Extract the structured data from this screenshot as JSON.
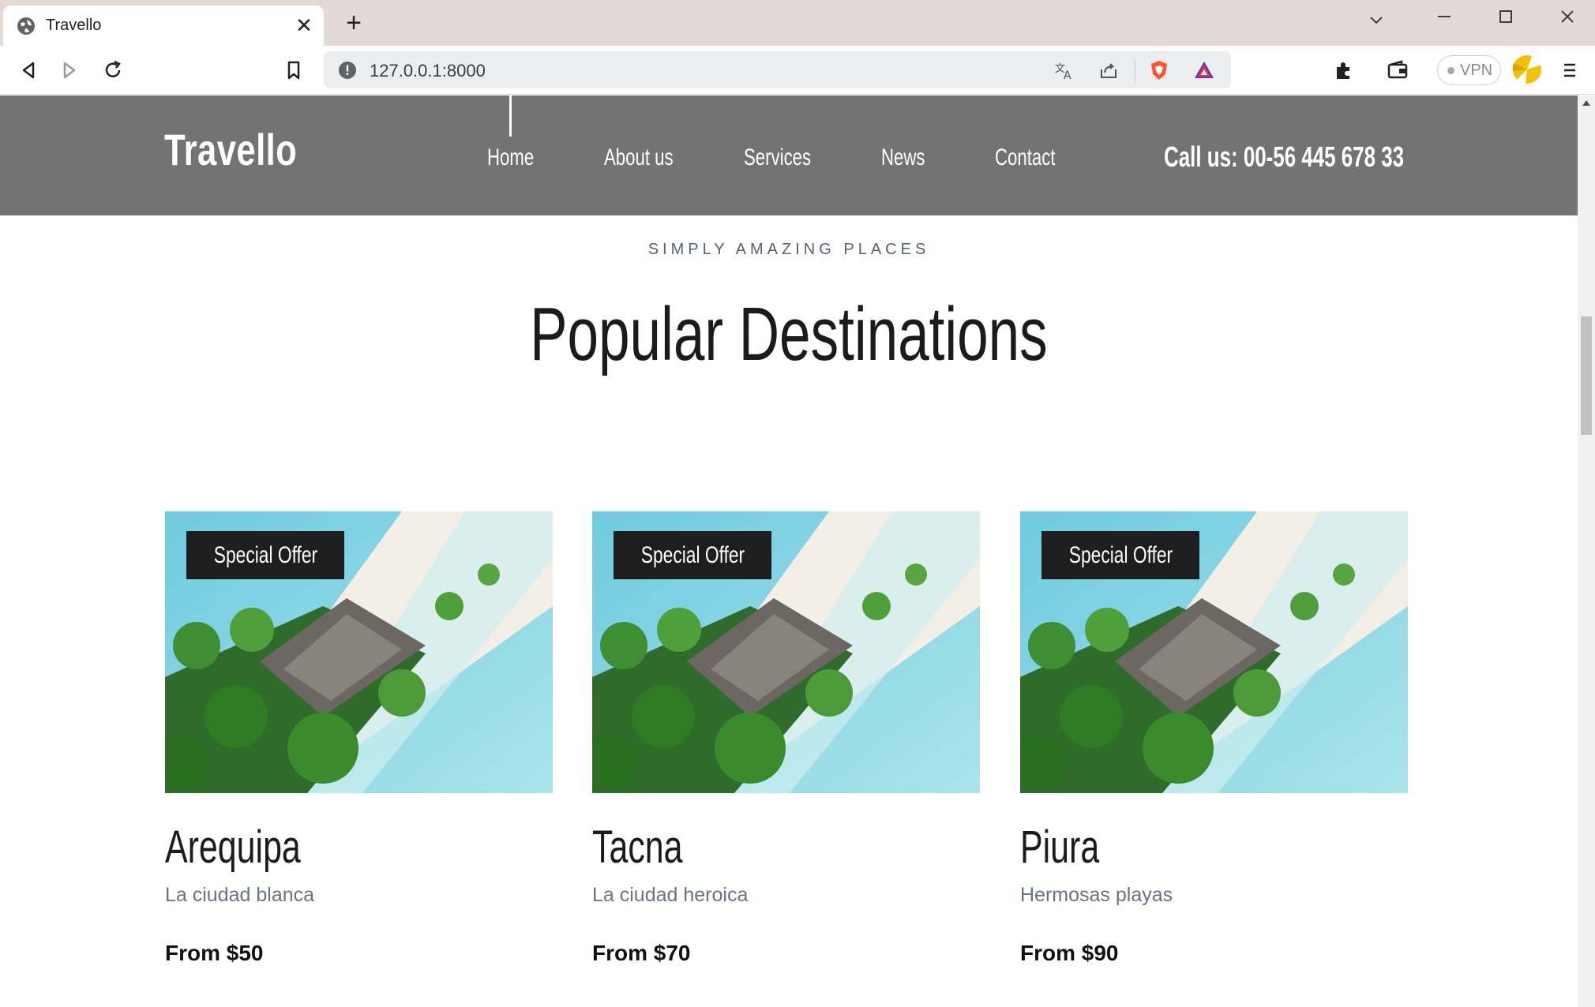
{
  "browser": {
    "tab_title": "Travello",
    "url": "127.0.0.1:8000",
    "vpn_label": "VPN"
  },
  "site": {
    "logo": "Travello",
    "nav": [
      "Home",
      "About us",
      "Services",
      "News",
      "Contact"
    ],
    "call": "Call us: 00-56 445 678 33"
  },
  "section": {
    "eyebrow": "SIMPLY AMAZING PLACES",
    "title": "Popular Destinations"
  },
  "destinations": [
    {
      "badge": "Special Offer",
      "city": "Arequipa",
      "description": "La ciudad blanca",
      "price": "From $50"
    },
    {
      "badge": "Special Offer",
      "city": "Tacna",
      "description": "La ciudad heroica",
      "price": "From $70"
    },
    {
      "badge": "Special Offer",
      "city": "Piura",
      "description": "Hermosas playas",
      "price": "From $90"
    }
  ],
  "colors": {
    "header_bg": "#737373",
    "tabbar_bg": "#e3dad6",
    "badge_bg": "#1e1e1e",
    "text_dark": "#1b1b1b",
    "text_muted": "#6b7285"
  }
}
